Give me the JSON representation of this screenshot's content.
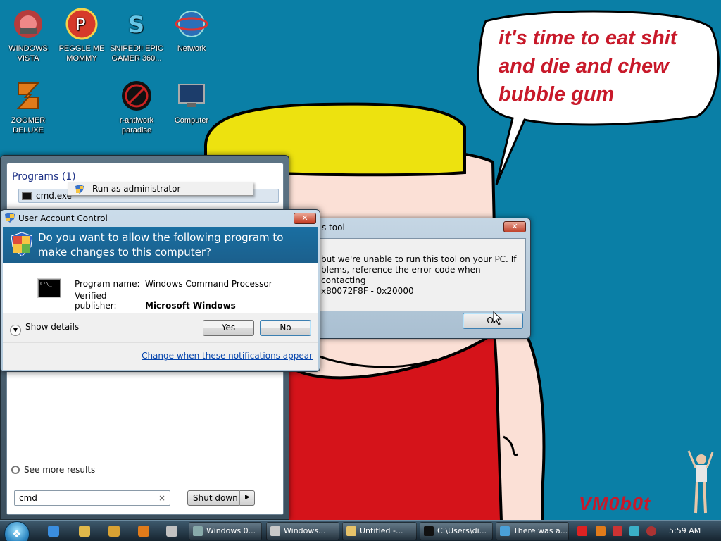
{
  "desktop": {
    "icons": [
      {
        "label": "WINDOWS VISTA"
      },
      {
        "label": "PEGGLE ME MOMMY"
      },
      {
        "label": "SNIPED!! EPIC GAMER 360..."
      },
      {
        "label": "Network"
      },
      {
        "label": "ZOOMER DELUXE"
      },
      {
        "label": "r-antiwork paradise"
      },
      {
        "label": "Computer"
      }
    ],
    "speech_bubble_text": "it's time to eat shit and die and chew bubble gum",
    "signature": "VM0b0t"
  },
  "start_menu": {
    "programs_heading": "Programs (1)",
    "result_item": "cmd.exe",
    "context_menu_item": "Run as administrator",
    "see_more": "See more results",
    "search_value": "cmd",
    "search_clear": "×",
    "shutdown_label": "Shut down",
    "shutdown_arrow": "▶"
  },
  "error_dialog": {
    "title": "s tool",
    "line1": "but we're unable to run this tool on your PC. If",
    "line2": "blems, reference the error code when contacting",
    "line3": "x80072F8F - 0x20000",
    "ok_label": "OK"
  },
  "uac": {
    "title": "User Account Control",
    "close": "✕",
    "question": "Do you want to allow the following program to make changes to this computer?",
    "program_name_label": "Program name:",
    "program_name_value": "Windows Command Processor",
    "publisher_label": "Verified publisher:",
    "publisher_value": "Microsoft Windows",
    "show_details": "Show details",
    "yes_label": "Yes",
    "no_label": "No",
    "change_link": "Change when these notifications appear",
    "icon_text": "C:\\_"
  },
  "taskbar": {
    "buttons": [
      {
        "label": "Windows 0..."
      },
      {
        "label": "Windows..."
      },
      {
        "label": "Untitled -..."
      },
      {
        "label": "C:\\Users\\di..."
      },
      {
        "label": "There was a..."
      }
    ],
    "clock": "5:59 AM"
  },
  "colors": {
    "desktop_bg": "#0a7fa6",
    "speech_text": "#c8192a",
    "uac_banner": "#1a6fa2"
  }
}
